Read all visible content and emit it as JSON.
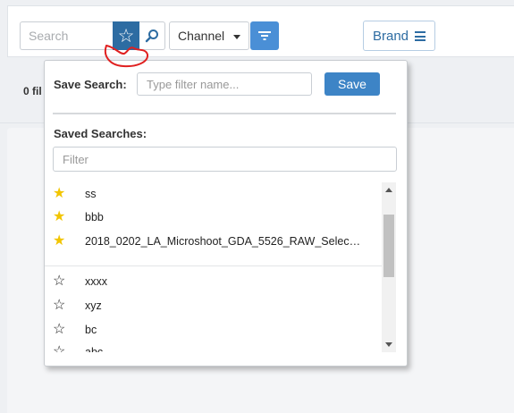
{
  "toolbar": {
    "search_placeholder": "Search",
    "channel_label": "Channel",
    "brand_label": "Brand"
  },
  "status": {
    "files_text": "0 fil"
  },
  "dropdown": {
    "save_search_label": "Save Search:",
    "name_placeholder": "Type filter name...",
    "save_button": "Save",
    "saved_searches_label": "Saved Searches:",
    "filter_placeholder": "Filter",
    "favorites": [
      {
        "label": "ss"
      },
      {
        "label": "bbb"
      },
      {
        "label": "2018_0202_LA_Microshoot_GDA_5526_RAW_Selec…"
      }
    ],
    "others": [
      {
        "label": "xxxx"
      },
      {
        "label": "xyz"
      },
      {
        "label": "bc"
      },
      {
        "label": "abc"
      }
    ]
  },
  "colors": {
    "accent": "#2d6ca2",
    "primary_button": "#3d84c6",
    "favorite_star": "#f2c500",
    "annotation": "#e02020"
  },
  "icons": {
    "star_button": "star-outline-icon",
    "search": "magnifier-icon",
    "filter": "filter-lines-icon",
    "brand_menu": "hamburger-icon"
  }
}
